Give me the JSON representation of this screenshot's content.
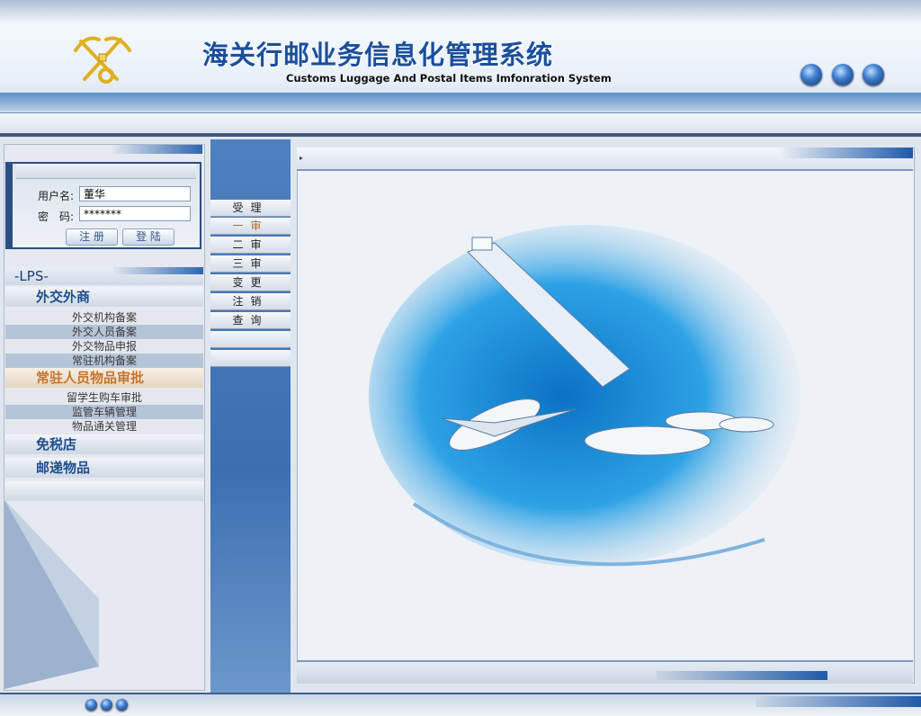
{
  "header": {
    "title_cn": "海关行邮业务信息化管理系统",
    "title_en": "Customs Luggage And Postal Items Imfonration System"
  },
  "login": {
    "username_label": "用户名:",
    "username_value": "董华",
    "password_label": "密　码:",
    "password_value": "*******",
    "register_label": "注 册",
    "login_label": "登 陆"
  },
  "sidebar": {
    "lps": "-LPS-",
    "cat1": {
      "label": "外交外商",
      "items": [
        "外交机构备案",
        "外交人员备案",
        "外交物品申报",
        "常驻机构备案"
      ]
    },
    "cat2": {
      "label": "常驻人员物品审批",
      "items": [
        "留学生购车审批",
        "监管车辆管理",
        "物品通关管理"
      ]
    },
    "cat3": {
      "label": "免税店"
    },
    "cat4": {
      "label": "邮递物品"
    }
  },
  "midnav": {
    "items": [
      "受理",
      "一审",
      "二审",
      "三审",
      "变更",
      "注销",
      "查询"
    ],
    "active_index": 1
  },
  "colors": {
    "brand": "#1b4f9c",
    "accent": "#c7762a"
  }
}
